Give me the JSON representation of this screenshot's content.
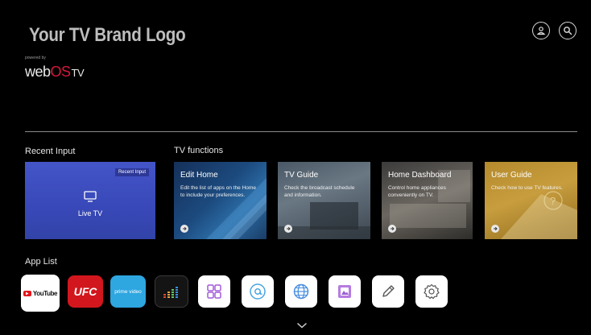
{
  "header": {
    "brand_logo": "Your TV Brand Logo",
    "powered_by": "powered by",
    "webos": {
      "web": "web",
      "os": "OS",
      "tv": "TV"
    }
  },
  "sections": {
    "recent_input": "Recent Input",
    "tv_functions": "TV functions",
    "app_list": "App List"
  },
  "recent_card": {
    "badge": "Recent Input",
    "label": "Live TV"
  },
  "tv_function_cards": [
    {
      "title": "Edit Home",
      "desc": "Edit the list of apps on the Home to include your preferences."
    },
    {
      "title": "TV Guide",
      "desc": "Check the broadcast schedule and information."
    },
    {
      "title": "Home Dashboard",
      "desc": "Control home appliances conveniently on TV."
    },
    {
      "title": "User Guide",
      "desc": "Check how to use TV features."
    }
  ],
  "apps": {
    "youtube": "YouTube",
    "ufc": "UFC",
    "prime": "prime video"
  },
  "icons": [
    "profile-icon",
    "search-icon",
    "tv-icon",
    "arrow-right-icon",
    "grid-icon",
    "at-icon",
    "globe-icon",
    "photo-icon",
    "pencil-icon",
    "gear-icon",
    "chevron-down-icon"
  ],
  "colors": {
    "background": "#000000",
    "live_tv_card": "#3f50c0",
    "ufc": "#d1171d",
    "prime_video": "#2ea6e0",
    "app_icon_accent": "#9b6ad6"
  }
}
